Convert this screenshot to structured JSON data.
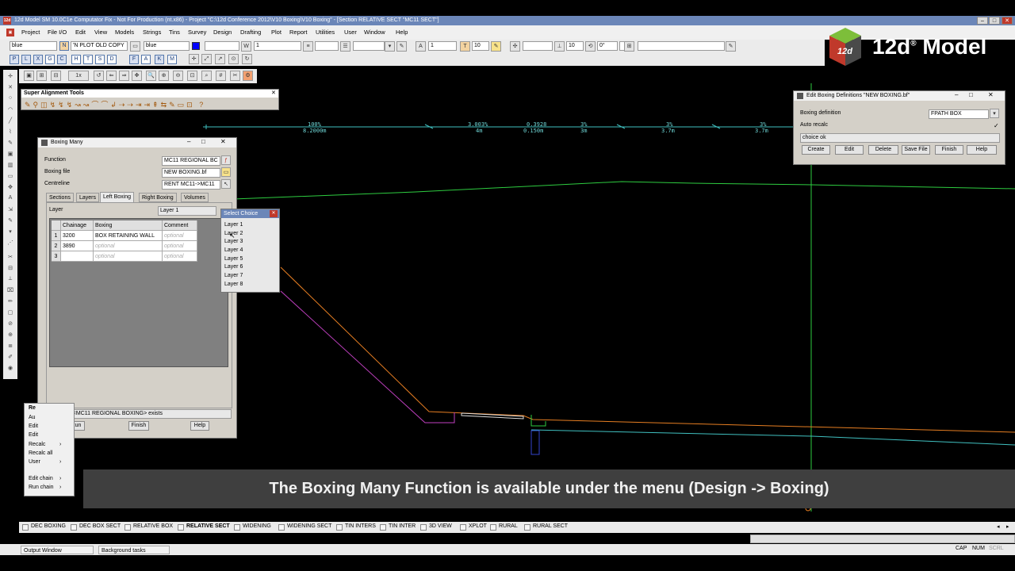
{
  "app": {
    "title": "12d Model SM 10.0C1e Computator Fix - Not For Production (nt.x86) - Project \"C:\\12d Conference 2012\\V10 Boxing\\V10 Boxing\" - [Section RELATIVE SECT \"MC11 SECT\"]",
    "menu": [
      "Project",
      "File I/O",
      "Edit",
      "View",
      "Models",
      "Strings",
      "Tins",
      "Survey",
      "Design",
      "Drafting",
      "Plot",
      "Report",
      "Utilities",
      "User",
      "Window",
      "Help"
    ]
  },
  "toolbar": {
    "colour": "blue",
    "model": "'N PLOT OLD COPY",
    "colour2": "blue",
    "weight": "1",
    "size1": "1",
    "text_size": "10",
    "angle_size": "10",
    "angle": "0°",
    "layer_buttons": [
      "P",
      "L",
      "X",
      "G",
      "C",
      "H",
      "T",
      "S",
      "D",
      "F",
      "A",
      "K",
      "M"
    ],
    "zoom_label": "1x"
  },
  "logo": {
    "text": "12d",
    "sup": "®",
    "text2": "Model",
    "cube_text": "12d"
  },
  "super_alignment": {
    "title": "Super Alignment Tools"
  },
  "boxing_many": {
    "title": "Boxing Many",
    "function_label": "Function",
    "function_value": "MC11 REGIONAL BC",
    "boxing_file_label": "Boxing file",
    "boxing_file_value": "NEW BOXING.bf",
    "centreline_label": "Centreline",
    "centreline_value": "RENT MC11->MC11",
    "tabs": [
      "Sections",
      "Layers",
      "Left Boxing",
      "Right Boxing",
      "Volumes"
    ],
    "layer_label": "Layer",
    "layer_value": "Layer 1",
    "columns": [
      "Chainage",
      "Boxing",
      "Comment"
    ],
    "rows": [
      {
        "n": "1",
        "chainage": "3200",
        "boxing": "BOX RETAINING WALL",
        "comment": "optional"
      },
      {
        "n": "2",
        "chainage": "3890",
        "boxing": "optional",
        "comment": "optional"
      },
      {
        "n": "3",
        "chainage": "",
        "boxing": "optional",
        "comment": "optional"
      }
    ],
    "status": "Function <MC11 REGIONAL BOXING> exists",
    "buttons": {
      "run": "Run",
      "finish": "Finish",
      "help": "Help"
    }
  },
  "select_choice": {
    "title": "Select Choice",
    "items": [
      "Layer 1",
      "Layer 2",
      "Layer 3",
      "Layer 4",
      "Layer 5",
      "Layer 6",
      "Layer 7",
      "Layer 8"
    ]
  },
  "edit_boxing": {
    "title": "Edit Boxing Definitions \"NEW BOXING.bf\"",
    "boxing_def_label": "Boxing definition",
    "boxing_def_value": "FPATH BOX",
    "auto_recalc_label": "Auto recalc",
    "message": "choice ok",
    "buttons": [
      "Create",
      "Edit",
      "Delete",
      "Save File",
      "Finish",
      "Help"
    ]
  },
  "context_menu": {
    "title": "Re",
    "items": [
      "Au",
      "Edit",
      "Edit",
      "Recalc",
      "Recalc all",
      "User",
      "Edit chain",
      "Run chain"
    ]
  },
  "profile_labels": [
    {
      "top": "100%",
      "bottom": "8.2000m"
    },
    {
      "top": "3.003%",
      "bottom": "4m"
    },
    {
      "top": "0.3928",
      "bottom": "0.150m"
    },
    {
      "top": "3%",
      "bottom": "3m"
    },
    {
      "top": "3%",
      "bottom": "3.7m"
    },
    {
      "top": "3%",
      "bottom": "3.7m"
    }
  ],
  "caption": "The Boxing Many Function is available under the menu (Design -> Boxing)",
  "view_tabs": [
    "DEC BOXING",
    "DEC BOX SECT",
    "RELATIVE BOX",
    "RELATIVE SECT",
    "WIDENING",
    "WIDENING SECT",
    "TIN INTERS",
    "TIN INTER",
    "3D VIEW",
    "XPLOT",
    "RURAL",
    "RURAL SECT"
  ],
  "status_bar": {
    "output_window": "Output Window",
    "background_tasks": "Background tasks",
    "indicators": [
      "CAP",
      "NUM",
      "SCRL"
    ]
  },
  "colors": {
    "title_bar": "#6b86b8",
    "canvas": "#000000",
    "banner": "#3f3f3f",
    "green_line": "#2ecc40",
    "orange_line": "#e67e22",
    "magenta_line": "#c040c0",
    "cyan_line": "#40c0c0"
  }
}
